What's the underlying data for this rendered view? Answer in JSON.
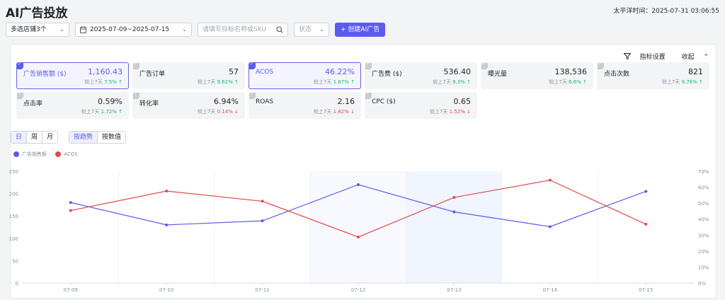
{
  "header": {
    "title": "AI广告投放",
    "timezone_label": "太平洋时间：",
    "timezone_value": "2025-07-31 03:06:55"
  },
  "toolbar": {
    "store_select": "多选店铺3个",
    "date_range": "2025-07-09~2025-07-15",
    "search_placeholder": "请填写目标名称或SKU",
    "status_select": "状态",
    "create_button": "创建AI广告"
  },
  "panel": {
    "settings_label": "指标设置",
    "collapse_label": "收起"
  },
  "metrics": [
    {
      "name": "广告销售额 ($)",
      "value": "1,160.43",
      "cmp_label": "较上7天",
      "cmp_value": "7.5%",
      "trend": "up",
      "selected": true
    },
    {
      "name": "广告订单",
      "value": "57",
      "cmp_label": "较上7天",
      "cmp_value": "9.62%",
      "trend": "up",
      "selected": false
    },
    {
      "name": "ACOS",
      "value": "46.22%",
      "cmp_label": "较上7天",
      "cmp_value": "1.67%",
      "trend": "up",
      "selected": true
    },
    {
      "name": "广告费 ($)",
      "value": "536.40",
      "cmp_label": "较上7天",
      "cmp_value": "9.3%",
      "trend": "up",
      "selected": false
    },
    {
      "name": "曝光量",
      "value": "138,536",
      "cmp_label": "较上7天",
      "cmp_value": "6.6%",
      "trend": "up",
      "selected": false
    },
    {
      "name": "点击次数",
      "value": "821",
      "cmp_label": "较上7天",
      "cmp_value": "9.76%",
      "trend": "up",
      "selected": false
    },
    {
      "name": "点击率",
      "value": "0.59%",
      "cmp_label": "较上7天",
      "cmp_value": "1.72%",
      "trend": "up",
      "selected": false
    },
    {
      "name": "转化率",
      "value": "6.94%",
      "cmp_label": "较上7天",
      "cmp_value": "0.14%",
      "trend": "down",
      "selected": false
    },
    {
      "name": "ROAS",
      "value": "2.16",
      "cmp_label": "较上7天",
      "cmp_value": "1.82%",
      "trend": "down",
      "selected": false
    },
    {
      "name": "CPC ($)",
      "value": "0.65",
      "cmp_label": "较上7天",
      "cmp_value": "1.52%",
      "trend": "down",
      "selected": false
    }
  ],
  "granularity": [
    "日",
    "周",
    "月"
  ],
  "view_mode": [
    "按趋势",
    "按数值"
  ],
  "icons": {
    "date": "calendar-icon",
    "search": "search-icon",
    "create": "plus-icon",
    "settings": "filter-icon",
    "collapse": "chevron-up-icon",
    "select": "chevron-down-icon"
  },
  "colors": {
    "primary": "#5b5bf0",
    "series_sales": "#5b5bf0",
    "series_acos": "#e5484d",
    "up": "#12b76a",
    "down": "#e5484d"
  },
  "chart_data": {
    "type": "line",
    "x": [
      "07-09",
      "07-10",
      "07-11",
      "07-12",
      "07-13",
      "07-14",
      "07-15"
    ],
    "series": [
      {
        "name": "广告销售额",
        "axis": "left",
        "color": "#5b5bf0",
        "values": [
          180,
          130,
          139,
          220,
          159,
          126,
          205
        ]
      },
      {
        "name": "ACOS",
        "axis": "right",
        "color": "#e5484d",
        "values": [
          45.4,
          57.6,
          51.2,
          28.8,
          53.6,
          64.4,
          36.8
        ]
      }
    ],
    "y_left": {
      "ticks": [
        0,
        50,
        100,
        150,
        200,
        250
      ],
      "range": [
        0,
        250
      ]
    },
    "y_right": {
      "ticks": [
        "0%",
        "10%",
        "20%",
        "30%",
        "40%",
        "50%",
        "60%",
        "70%"
      ],
      "range": [
        0,
        70
      ]
    },
    "grid": true,
    "highlight_bands": [
      "07-12",
      "07-13"
    ]
  }
}
